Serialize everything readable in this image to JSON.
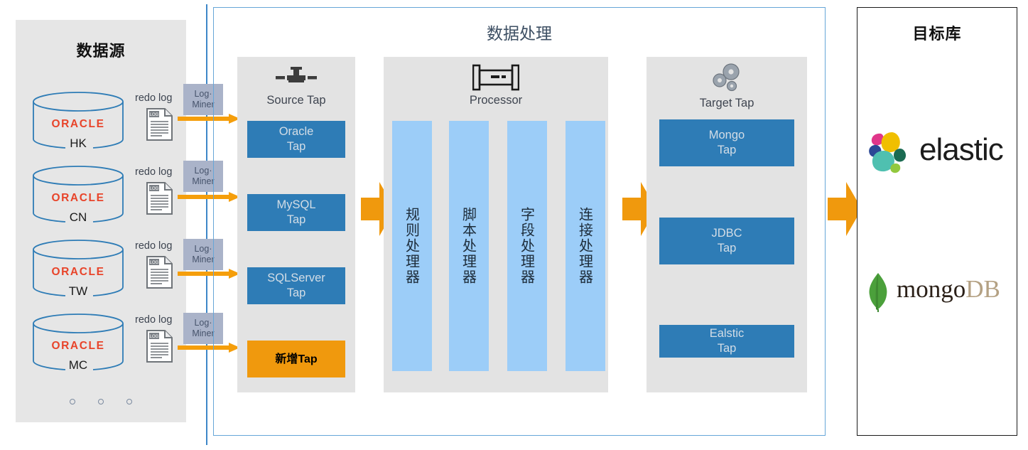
{
  "colors": {
    "panel_bg": "#e6e6e6",
    "card_bg": "#e3e3e3",
    "tap_blue": "#2e7cb6",
    "processor_bar": "#9ccdf8",
    "accent_orange": "#f0990d",
    "logminer_bg": "#aab3c9",
    "container_border": "#66a6d8",
    "oracle_red": "#e8442a",
    "cylinder_stroke": "#2e7cb6"
  },
  "source_panel": {
    "title": "数据源",
    "databases": [
      {
        "vendor": "ORACLE",
        "region": "HK",
        "log_label": "redo log",
        "doc_tag": "LOG"
      },
      {
        "vendor": "ORACLE",
        "region": "CN",
        "log_label": "redo log",
        "doc_tag": "LOG"
      },
      {
        "vendor": "ORACLE",
        "region": "TW",
        "log_label": "redo log",
        "doc_tag": "LOG"
      },
      {
        "vendor": "ORACLE",
        "region": "MC",
        "log_label": "redo log",
        "doc_tag": "LOG"
      }
    ],
    "more_indicator": "○ ○ ○"
  },
  "connectors": {
    "logminer_label_line1": "Log·",
    "logminer_label_line2": "Miner",
    "count": 4
  },
  "processing": {
    "title": "数据处理",
    "source_tap": {
      "name": "Source Tap",
      "icon": "pipe-tap-icon",
      "taps": [
        {
          "line1": "Oracle",
          "line2": "Tap",
          "style": "blue"
        },
        {
          "line1": "MySQL",
          "line2": "Tap",
          "style": "blue"
        },
        {
          "line1": "SQLServer",
          "line2": "Tap",
          "style": "blue"
        },
        {
          "line1": "新增Tap",
          "line2": "",
          "style": "orange"
        }
      ]
    },
    "processor": {
      "name": "Processor",
      "icon": "processor-icon",
      "bars": [
        {
          "label": "规则处理器"
        },
        {
          "label": "脚本处理器"
        },
        {
          "label": "字段处理器"
        },
        {
          "label": "连接处理器"
        }
      ]
    },
    "target_tap": {
      "name": "Target Tap",
      "icon": "gears-icon",
      "taps": [
        {
          "line1": "Mongo",
          "line2": "Tap"
        },
        {
          "line1": "JDBC",
          "line2": "Tap"
        },
        {
          "line1": "Ealstic",
          "line2": "Tap"
        }
      ]
    }
  },
  "target_panel": {
    "title": "目标库",
    "logos": [
      {
        "name": "elastic",
        "text": "elastic"
      },
      {
        "name": "mongodb",
        "text_dark": "mongo",
        "text_light": "DB"
      }
    ]
  }
}
